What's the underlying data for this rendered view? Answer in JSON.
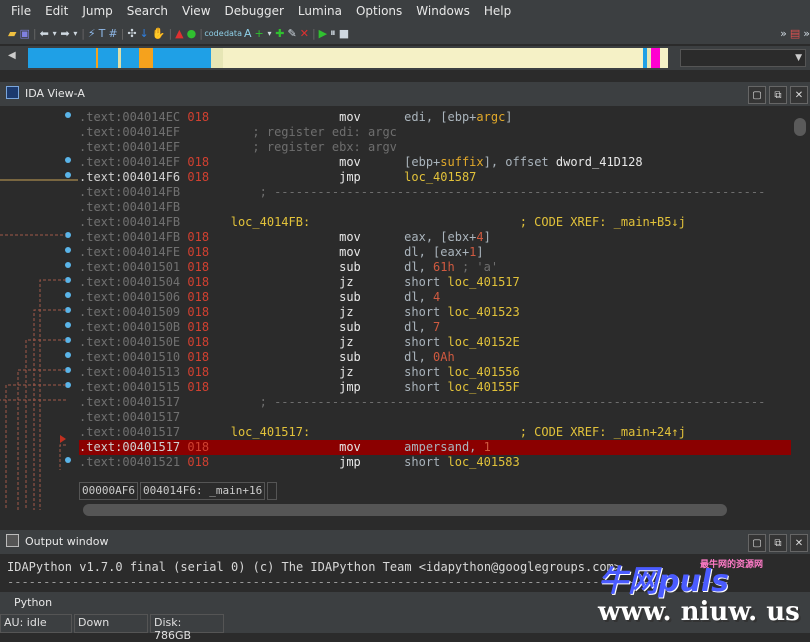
{
  "menu": [
    "File",
    "Edit",
    "Jump",
    "Search",
    "View",
    "Debugger",
    "Lumina",
    "Options",
    "Windows",
    "Help"
  ],
  "navstrip_colors": [
    "#dedfa8",
    "#1fa0e6",
    "#f5a21d",
    "#1fa0e6",
    "#e6e6b5",
    "#1fa0e6",
    "#f5f5c8",
    "#dedfa8"
  ],
  "ida_view": {
    "title": "IDA View-A",
    "lines": [
      {
        "addr": ".text:004014EC",
        "stk": "018",
        "mn": "mov",
        "ops": [
          [
            "op",
            "edi, [ebp+"
          ],
          [
            "var",
            "argc"
          ],
          [
            "op",
            "]"
          ]
        ]
      },
      {
        "addr": ".text:004014EF",
        "stk": "",
        "mn": "",
        "comment": "; register edi: argc"
      },
      {
        "addr": ".text:004014EF",
        "stk": "",
        "mn": "",
        "comment": "; register ebx: argv"
      },
      {
        "addr": ".text:004014EF",
        "stk": "018",
        "mn": "mov",
        "ops": [
          [
            "op",
            "[ebp+"
          ],
          [
            "var",
            "suffix"
          ],
          [
            "op",
            "], offset "
          ],
          [
            "mn",
            "dword_41D128"
          ]
        ]
      },
      {
        "addr": ".text:004014F6",
        "stk": "018",
        "mn": "jmp",
        "ops": [
          [
            "lbl",
            "loc_401587"
          ]
        ],
        "hi": true
      },
      {
        "addr": ".text:004014FB",
        "sep": "; ---------------------------------------------------------------------------"
      },
      {
        "addr": ".text:004014FB",
        "stk": ""
      },
      {
        "addr": ".text:004014FB",
        "label": "loc_4014FB:",
        "xref": "; CODE XREF: _main+B5↓j"
      },
      {
        "addr": ".text:004014FB",
        "stk": "018",
        "mn": "mov",
        "ops": [
          [
            "op",
            "eax, [ebx+"
          ],
          [
            "num",
            "4"
          ],
          [
            "op",
            "]"
          ]
        ]
      },
      {
        "addr": ".text:004014FE",
        "stk": "018",
        "mn": "mov",
        "ops": [
          [
            "op",
            "dl, [eax+"
          ],
          [
            "num",
            "1"
          ],
          [
            "op",
            "]"
          ]
        ]
      },
      {
        "addr": ".text:00401501",
        "stk": "018",
        "mn": "sub",
        "ops": [
          [
            "op",
            "dl, "
          ],
          [
            "num",
            "61h"
          ],
          [
            "cmt",
            " ; 'a'"
          ]
        ]
      },
      {
        "addr": ".text:00401504",
        "stk": "018",
        "mn": "jz",
        "ops": [
          [
            "op",
            "short "
          ],
          [
            "lbl",
            "loc_401517"
          ]
        ]
      },
      {
        "addr": ".text:00401506",
        "stk": "018",
        "mn": "sub",
        "ops": [
          [
            "op",
            "dl, "
          ],
          [
            "num",
            "4"
          ]
        ]
      },
      {
        "addr": ".text:00401509",
        "stk": "018",
        "mn": "jz",
        "ops": [
          [
            "op",
            "short "
          ],
          [
            "lbl",
            "loc_401523"
          ]
        ]
      },
      {
        "addr": ".text:0040150B",
        "stk": "018",
        "mn": "sub",
        "ops": [
          [
            "op",
            "dl, "
          ],
          [
            "num",
            "7"
          ]
        ]
      },
      {
        "addr": ".text:0040150E",
        "stk": "018",
        "mn": "jz",
        "ops": [
          [
            "op",
            "short "
          ],
          [
            "lbl",
            "loc_40152E"
          ]
        ]
      },
      {
        "addr": ".text:00401510",
        "stk": "018",
        "mn": "sub",
        "ops": [
          [
            "op",
            "dl, "
          ],
          [
            "num",
            "0Ah"
          ]
        ]
      },
      {
        "addr": ".text:00401513",
        "stk": "018",
        "mn": "jz",
        "ops": [
          [
            "op",
            "short "
          ],
          [
            "lbl",
            "loc_401556"
          ]
        ]
      },
      {
        "addr": ".text:00401515",
        "stk": "018",
        "mn": "jmp",
        "ops": [
          [
            "op",
            "short "
          ],
          [
            "lbl",
            "loc_40155F"
          ]
        ]
      },
      {
        "addr": ".text:00401517",
        "sep": "; ---------------------------------------------------------------------------"
      },
      {
        "addr": ".text:00401517",
        "stk": ""
      },
      {
        "addr": ".text:00401517",
        "label": "loc_401517:",
        "xref": "; CODE XREF: _main+24↑j"
      },
      {
        "addr": ".text:00401517",
        "stk": "018",
        "mn": "mov",
        "ops": [
          [
            "op",
            "ampersand, "
          ],
          [
            "num",
            "1"
          ]
        ],
        "selected": true
      },
      {
        "addr": ".text:00401521",
        "stk": "018",
        "mn": "jmp",
        "ops": [
          [
            "op",
            "short "
          ],
          [
            "lbl",
            "loc_401583"
          ]
        ]
      }
    ],
    "status_offset": "00000AF6",
    "status_location": "004014F6: _main+16"
  },
  "output": {
    "title": "Output window",
    "line1": "IDAPython v1.7.0 final (serial 0) (c) The IDAPython Team <idapython@googlegroups.com>",
    "line2": "----------------------------------------------------------------------------------------------------",
    "lang": "Python"
  },
  "statusbar": {
    "au": "AU:  idle",
    "dir": "Down",
    "disk": "Disk: 786GB"
  },
  "watermark": {
    "brand": "牛网puls",
    "url": "www. niuw. us",
    "tag": "最牛网的资源网"
  }
}
